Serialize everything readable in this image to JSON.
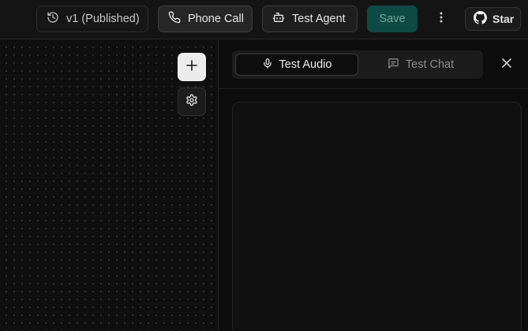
{
  "toolbar": {
    "version_label": "v1 (Published)",
    "phone_call_label": "Phone Call",
    "test_agent_label": "Test Agent",
    "save_label": "Save",
    "star_label": "Star"
  },
  "icons": {
    "version": "history-icon",
    "phone_call": "phone-icon",
    "test_agent": "bot-icon",
    "more": "more-vertical-icon",
    "star": "github-icon",
    "add": "plus-icon",
    "settings": "gear-icon",
    "test_audio": "microphone-icon",
    "test_chat": "chat-icon",
    "close": "close-icon"
  },
  "panel": {
    "tabs": [
      {
        "label": "Test Audio",
        "active": true
      },
      {
        "label": "Test Chat",
        "active": false
      }
    ]
  },
  "colors": {
    "background": "#0d0d0d",
    "save_button": "#0e4a43",
    "save_text": "#6fa79d"
  }
}
